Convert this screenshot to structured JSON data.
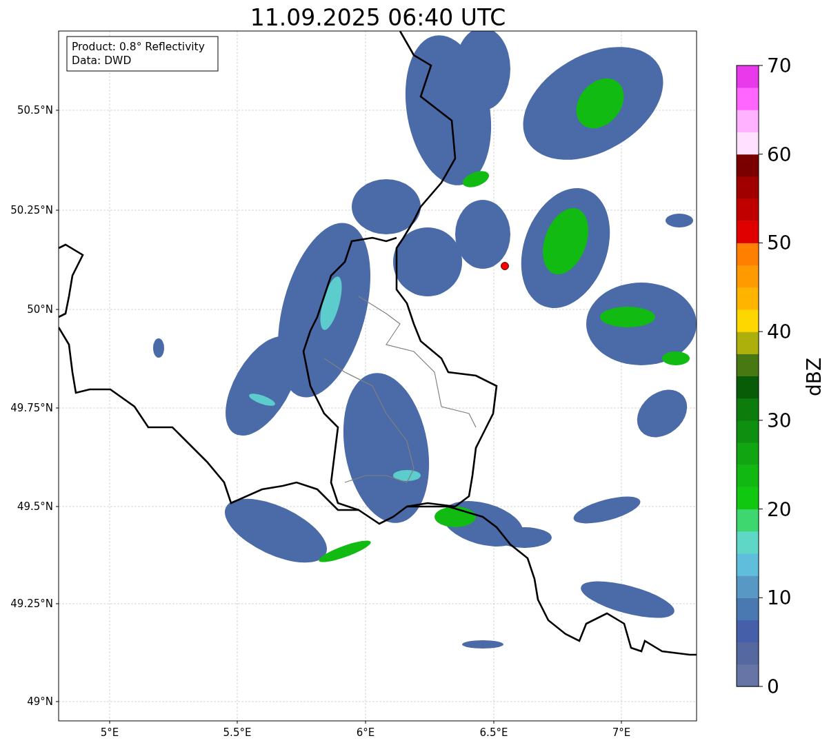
{
  "title": "11.09.2025 06:40 UTC",
  "legend": [
    "Product: 0.8° Reflectivity",
    "Data: DWD"
  ],
  "map": {
    "lat_labels": [
      {
        "label": "50.5°N"
      },
      {
        "label": "50.25°N"
      },
      {
        "label": "50°N"
      },
      {
        "label": "49.75°N"
      },
      {
        "label": "49.5°N"
      },
      {
        "label": "49.25°N"
      },
      {
        "label": "49°N"
      }
    ],
    "lon_labels": [
      {
        "label": "5°E"
      },
      {
        "label": "5.5°E"
      },
      {
        "label": "6°E"
      },
      {
        "label": "6.5°E"
      },
      {
        "label": "7°E"
      }
    ]
  },
  "colorbar": {
    "label": "dBZ",
    "ticks": [
      "70",
      "60",
      "50",
      "40",
      "30",
      "20",
      "10",
      "0"
    ],
    "bands": [
      {
        "color": "#6674a6"
      },
      {
        "color": "#5568a0"
      },
      {
        "color": "#4560a8"
      },
      {
        "color": "#4a78b0"
      },
      {
        "color": "#5898c4"
      },
      {
        "color": "#60bedd"
      },
      {
        "color": "#5fd7c6"
      },
      {
        "color": "#3ed66e"
      },
      {
        "color": "#11c811"
      },
      {
        "color": "#11b811"
      },
      {
        "color": "#11a511"
      },
      {
        "color": "#0f8f0f"
      },
      {
        "color": "#0c7c0c"
      },
      {
        "color": "#085c08"
      },
      {
        "color": "#487811"
      },
      {
        "color": "#adb00a"
      },
      {
        "color": "#ffd700"
      },
      {
        "color": "#ffb400"
      },
      {
        "color": "#ff9a00"
      },
      {
        "color": "#ff7f00"
      },
      {
        "color": "#e00000"
      },
      {
        "color": "#c00000"
      },
      {
        "color": "#a00000"
      },
      {
        "color": "#7a0000"
      },
      {
        "color": "#ffe0ff"
      },
      {
        "color": "#ffb2ff"
      },
      {
        "color": "#ff66ff"
      },
      {
        "color": "#e83aeb"
      }
    ]
  }
}
